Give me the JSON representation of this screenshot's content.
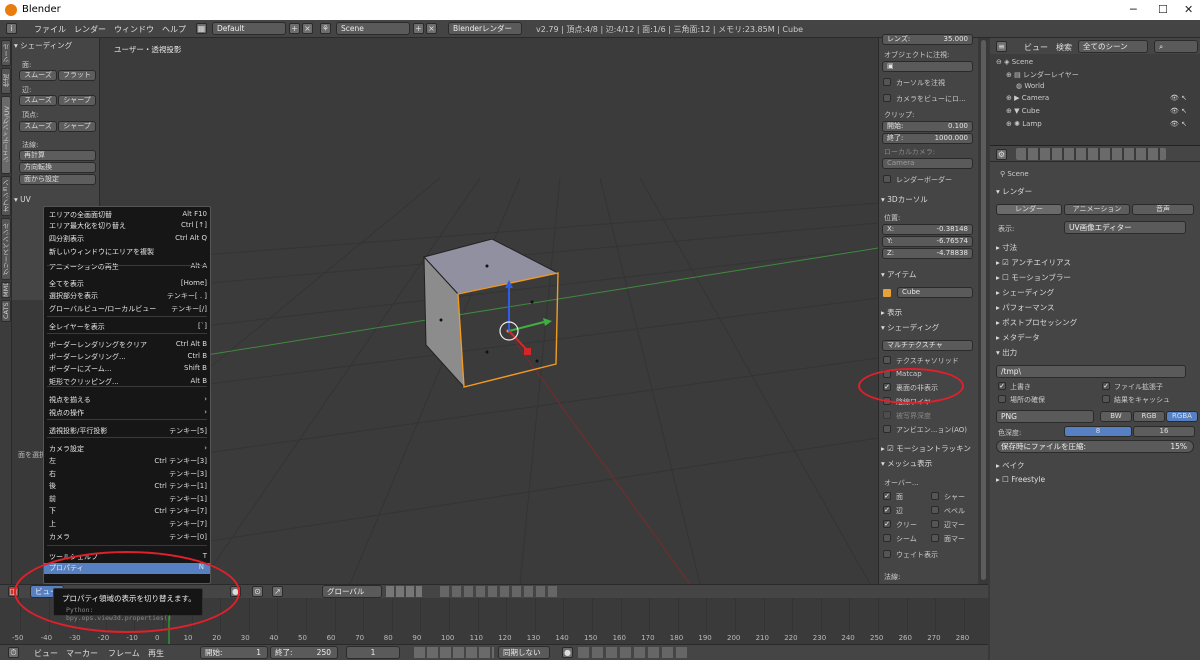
{
  "window": {
    "title": "Blender",
    "minimize": "─",
    "maximize": "☐",
    "close": "✕"
  },
  "infobar": {
    "menus": [
      "ファイル",
      "レンダー",
      "ウィンドウ",
      "ヘルプ"
    ],
    "layout": "Default",
    "scene": "Scene",
    "engine": "Blenderレンダー",
    "stats": "v2.79 | 頂点:4/8 | 辺:4/12 | 面:1/6 | 三角面:12 | メモリ:23.85M | Cube"
  },
  "tool_shelf": {
    "shading_header": "シェーディング",
    "face_label": "面:",
    "smooth": "スムーズ",
    "flat": "フラット",
    "edge_label": "辺:",
    "smooth2": "スムーズ",
    "sharp": "シャープ",
    "vertex_label": "頂点:",
    "smooth3": "スムーズ",
    "sharp2": "シャープ",
    "normals_label": "法線:",
    "recalc": "再計算",
    "flip": "方向転換",
    "set_from_faces": "面から設定",
    "uv_header": "UV",
    "tabs": [
      "ツール",
      "作成",
      "シェーディング/UV",
      "オプション",
      "グリースペンシル",
      "CATS",
      "MMD"
    ]
  },
  "viewport": {
    "title": "ユーザー・透視投影",
    "face_select_label": "面を選択"
  },
  "context_menu": {
    "items": [
      {
        "label": "エリアの全画面切替",
        "shortcut": "Alt F10"
      },
      {
        "label": "エリア最大化を切り替え",
        "shortcut": "Ctrl [↑]"
      },
      {
        "label": "四分割表示",
        "shortcut": "Ctrl Alt Q"
      },
      {
        "label": "新しいウィンドウにエリアを複製",
        "shortcut": ""
      },
      {
        "label": "アニメーションの再生",
        "shortcut": "Alt A"
      },
      {
        "label": "全てを表示",
        "shortcut": "[Home]"
      },
      {
        "label": "選択部分を表示",
        "shortcut": "テンキー[ . ]"
      },
      {
        "label": "グローバルビュー/ローカルビュー",
        "shortcut": "テンキー[/]"
      },
      {
        "label": "全レイヤーを表示",
        "shortcut": "[`]"
      },
      {
        "label": "ボーダーレンダリングをクリア",
        "shortcut": "Ctrl Alt B"
      },
      {
        "label": "ボーダーレンダリング...",
        "shortcut": "Ctrl B"
      },
      {
        "label": "ボーダーにズーム...",
        "shortcut": "Shift B"
      },
      {
        "label": "矩形でクリッピング...",
        "shortcut": "Alt B"
      },
      {
        "label": "視点を揃える",
        "shortcut": "›"
      },
      {
        "label": "視点の操作",
        "shortcut": "›"
      },
      {
        "label": "透視投影/平行投影",
        "shortcut": "テンキー[5]"
      },
      {
        "label": "カメラ設定",
        "shortcut": "›"
      },
      {
        "label": "左",
        "shortcut": "Ctrl テンキー[3]"
      },
      {
        "label": "右",
        "shortcut": "テンキー[3]"
      },
      {
        "label": "後",
        "shortcut": "Ctrl テンキー[1]"
      },
      {
        "label": "前",
        "shortcut": "テンキー[1]"
      },
      {
        "label": "下",
        "shortcut": "Ctrl テンキー[7]"
      },
      {
        "label": "上",
        "shortcut": "テンキー[7]"
      },
      {
        "label": "カメラ",
        "shortcut": "テンキー[0]"
      },
      {
        "label": "ツールシェルフ",
        "shortcut": "T"
      },
      {
        "label": "プロパティ",
        "shortcut": "N"
      }
    ]
  },
  "tooltip": {
    "title": "プロパティ領域の表示を切り替えます。",
    "python": "Python: bpy.ops.view3d.properties()"
  },
  "npanel": {
    "lens": "レンズ:",
    "lens_val": "35.000",
    "lock_object": "オブジェクトに注視:",
    "lock_cursor": "カーソルを注視",
    "lock_camera": "カメラをビューにロ...",
    "clip": "クリップ:",
    "clip_start": "開始:",
    "clip_start_val": "0.100",
    "clip_end": "終了:",
    "clip_end_val": "1000.000",
    "local_camera": "ローカルカメラ:",
    "camera_field": "Camera",
    "render_border": "レンダーボーダー",
    "cursor_header": "3Dカーソル",
    "location": "位置:",
    "cx": "X:",
    "cx_val": "-0.38148",
    "cy": "Y:",
    "cy_val": "-6.76574",
    "cz": "Z:",
    "cz_val": "-4.78838",
    "item_header": "アイテム",
    "item_name": "Cube",
    "display_header": "表示",
    "shading_header": "シェーディング",
    "shading_mode": "マルチテクスチャ",
    "tex_solid": "テクスチャソリッド",
    "matcap": "Matcap",
    "backface": "裏面の非表示",
    "hidden_wire": "陰線ワイヤ",
    "dof": "被写界深度",
    "ao": "アンビエン...ョン(AO)",
    "motion_tracking": "モーショントラッキン",
    "mesh_display": "メッシュ表示",
    "overlay": "オーバー...",
    "faces": "面",
    "sharp": "シャー",
    "edges": "辺",
    "bevel": "ベベル",
    "crease": "クリー",
    "edge_mark": "辺マー",
    "seam": "シーム",
    "face_mark": "面マー",
    "weight": "ウェイト表示",
    "normals": "法線:"
  },
  "outliner": {
    "view": "ビュー",
    "search": "検索",
    "scenes": "全てのシーン",
    "items": [
      "Scene",
      "レンダーレイヤー",
      "World",
      "Camera",
      "Cube",
      "Lamp"
    ]
  },
  "properties": {
    "context": "Scene",
    "render_header": "レンダー",
    "tab_render": "レンダー",
    "tab_anim": "アニメーション",
    "tab_sound": "音声",
    "display_label": "表示:",
    "display_value": "UV画像エディター",
    "sections": [
      "寸法",
      "アンチエイリアス",
      "モーションブラー",
      "シェーディング",
      "パフォーマンス",
      "ポストプロセッシング",
      "メタデータ"
    ],
    "output_header": "出力",
    "output_path": "/tmp\\",
    "overwrite": "上書き",
    "file_ext": "ファイル拡張子",
    "placeholders": "場所の確保",
    "cache_result": "結果をキャッシュ",
    "format": "PNG",
    "bw": "BW",
    "rgb": "RGB",
    "rgba": "RGBA",
    "color_depth": "色深度:",
    "depth_8": "8",
    "depth_16": "16",
    "compression": "保存時にファイルを圧縮:",
    "compression_val": "15%",
    "bake": "ベイク",
    "freestyle": "Freestyle"
  },
  "header3d": {
    "view_menu": "ビュー",
    "orientation": "グローバル"
  },
  "timeline": {
    "ticks": [
      "-50",
      "-40",
      "-30",
      "-20",
      "-10",
      "0",
      "10",
      "20",
      "30",
      "40",
      "50",
      "60",
      "70",
      "80",
      "90",
      "100",
      "110",
      "120",
      "130",
      "140",
      "150",
      "160",
      "170",
      "180",
      "190",
      "200",
      "210",
      "220",
      "230",
      "240",
      "250",
      "260",
      "270",
      "280"
    ],
    "menus": [
      "ビュー",
      "マーカー",
      "フレーム",
      "再生"
    ],
    "start_label": "開始:",
    "start_val": "1",
    "end_label": "終了:",
    "end_val": "250",
    "current": "1",
    "sync": "同期しない"
  }
}
